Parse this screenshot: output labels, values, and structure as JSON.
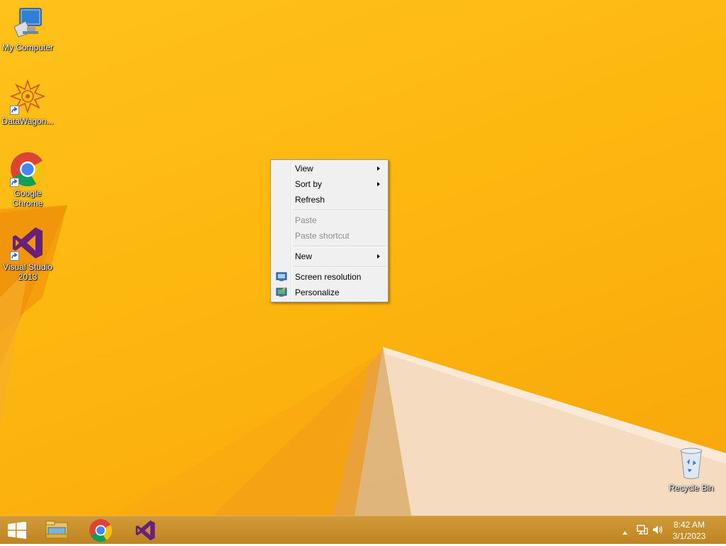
{
  "desktop": {
    "icons": [
      {
        "label": "My Computer",
        "icon": "my-computer-icon"
      },
      {
        "label": "DataWagon...",
        "icon": "datawagon-icon"
      },
      {
        "label": "Google Chrome",
        "icon": "chrome-icon"
      },
      {
        "label": "Visual Studio 2013",
        "icon": "visual-studio-icon"
      },
      {
        "label": "Recycle Bin",
        "icon": "recycle-bin-icon"
      }
    ]
  },
  "context_menu": {
    "items": [
      {
        "label": "View",
        "has_submenu": true,
        "enabled": true
      },
      {
        "label": "Sort by",
        "has_submenu": true,
        "enabled": true
      },
      {
        "label": "Refresh",
        "enabled": true
      },
      {
        "label": "Paste",
        "enabled": false
      },
      {
        "label": "Paste shortcut",
        "enabled": false
      },
      {
        "label": "New",
        "has_submenu": true,
        "enabled": true
      },
      {
        "label": "Screen resolution",
        "icon": "screen-resolution-icon",
        "enabled": true
      },
      {
        "label": "Personalize",
        "icon": "personalize-icon",
        "enabled": true
      }
    ]
  },
  "taskbar": {
    "pinned": [
      {
        "icon": "file-explorer-icon"
      },
      {
        "icon": "chrome-icon"
      },
      {
        "icon": "visual-studio-icon"
      }
    ],
    "tray": {
      "icons": [
        "show-hidden-icons-icon",
        "network-icon",
        "volume-icon"
      ]
    },
    "clock": {
      "time": "8:42 AM",
      "date": "3/1/2023"
    }
  },
  "colors": {
    "wallpaper": "#fdb70f",
    "taskbar": "#c58a24",
    "menu_bg": "#f0f0f0",
    "disabled_text": "#8d8d8d"
  }
}
